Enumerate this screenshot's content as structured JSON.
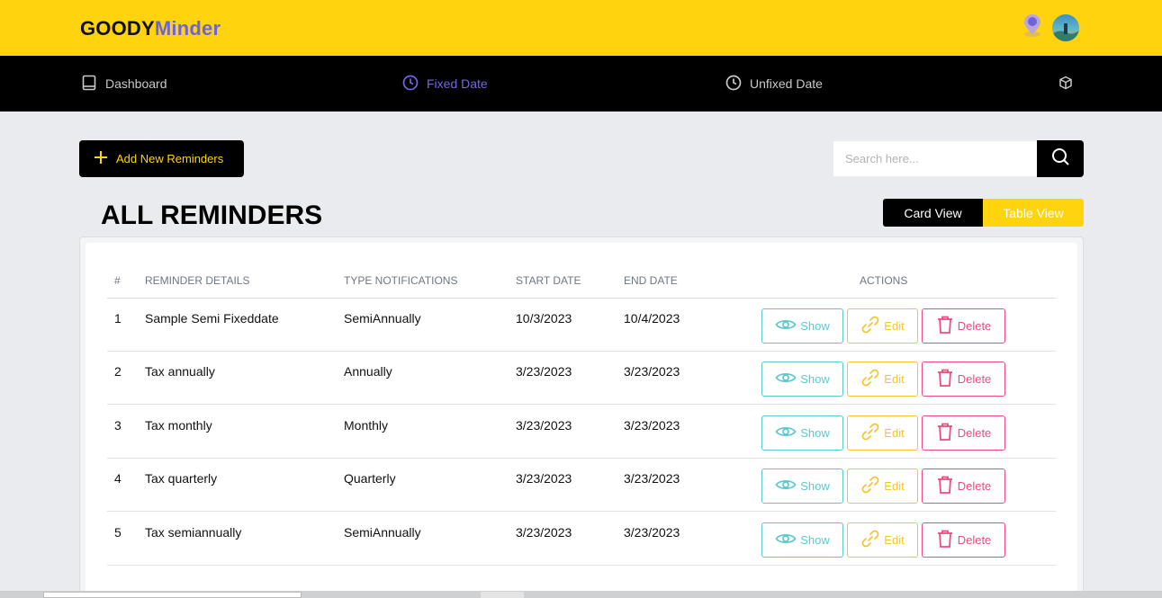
{
  "header": {
    "brand_part1": "GOODY",
    "brand_part2": "Minder",
    "notification_icon": "location-pin-icon",
    "avatar": "user-avatar"
  },
  "nav": {
    "items": [
      {
        "label": "Dashboard",
        "icon": "book-icon",
        "active": false
      },
      {
        "label": "Fixed Date",
        "icon": "clock-icon",
        "active": true
      },
      {
        "label": "Unfixed Date",
        "icon": "clock-icon",
        "active": false
      },
      {
        "label": "",
        "icon": "cube-icon",
        "active": false
      }
    ]
  },
  "toolbar": {
    "add_label": "Add New Reminders",
    "search_placeholder": "Search here..."
  },
  "main": {
    "title": "ALL REMINDERS",
    "view_card_label": "Card View",
    "view_table_label": "Table View"
  },
  "table": {
    "headers": [
      "#",
      "REMINDER DETAILS",
      "TYPE NOTIFICATIONS",
      "START DATE",
      "END DATE",
      "ACTIONS"
    ],
    "rows": [
      {
        "num": "1",
        "details": "Sample Semi Fixeddate",
        "type": "SemiAnnually",
        "start": "10/3/2023",
        "end": "10/4/2023"
      },
      {
        "num": "2",
        "details": "Tax annually",
        "type": "Annually",
        "start": "3/23/2023",
        "end": "3/23/2023"
      },
      {
        "num": "3",
        "details": "Tax monthly",
        "type": "Monthly",
        "start": "3/23/2023",
        "end": "3/23/2023"
      },
      {
        "num": "4",
        "details": "Tax quarterly",
        "type": "Quarterly",
        "start": "3/23/2023",
        "end": "3/23/2023"
      },
      {
        "num": "5",
        "details": "Tax semiannually",
        "type": "SemiAnnually",
        "start": "3/23/2023",
        "end": "3/23/2023"
      }
    ],
    "actions": {
      "show": "Show",
      "edit": "Edit",
      "delete": "Delete"
    }
  },
  "colors": {
    "brand_yellow": "#ffd30e",
    "brand_purple": "#6f63d8",
    "show": "#5cc9cd",
    "edit": "#f4c430",
    "delete": "#ef4b7e"
  }
}
